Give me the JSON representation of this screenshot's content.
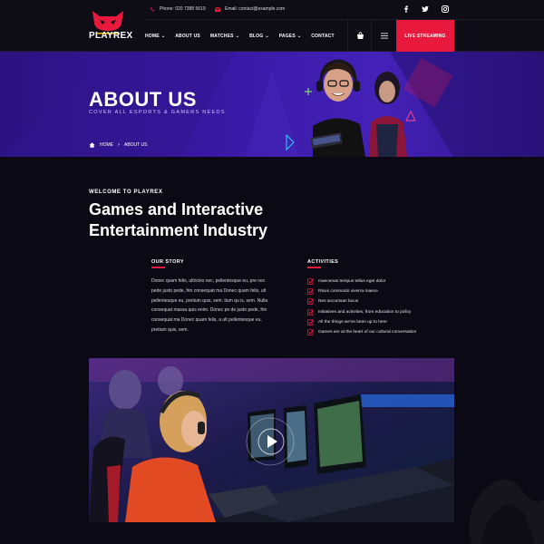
{
  "brand": {
    "name": "PLAYREX"
  },
  "topbar": {
    "phone": "Phone: 020 7388 5619",
    "email": "Email: contact@example.com",
    "social": [
      "facebook-icon",
      "twitter-icon",
      "instagram-icon"
    ]
  },
  "nav": {
    "items": [
      {
        "label": "HOME",
        "has_dropdown": true
      },
      {
        "label": "ABOUT US",
        "has_dropdown": false
      },
      {
        "label": "MATCHES",
        "has_dropdown": true
      },
      {
        "label": "BLOG",
        "has_dropdown": true
      },
      {
        "label": "PAGES",
        "has_dropdown": true
      },
      {
        "label": "CONTACT",
        "has_dropdown": false
      }
    ],
    "cta": "LIVE STREAMING"
  },
  "hero": {
    "title": "ABOUT US",
    "subtitle": "COVER ALL ESPORTS & GAMERS NEEDS",
    "breadcrumb": [
      "HOME",
      "ABOUT US"
    ]
  },
  "intro": {
    "kicker": "WELCOME TO PLAYREX",
    "headline": "Games and Interactive Entertainment Industry"
  },
  "story": {
    "title": "OUR STORY",
    "text": "Donec quam felis, ultricies nec, pellentesque eu, pre nec pede justo pede, frin consequat ma Donec quam felis, ult pellentesque eu, pretium quis, sem. tium qu is, sem. Nulla consequat massa quis enim. Donec pe de justo pede, frin consequat ma Donec quam felis, a ult pellentesque eu, pretium quis, sem."
  },
  "activities": {
    "title": "ACTIVITIES",
    "items": [
      "maecenas tempus tellus eget dolor",
      "Risus commodo viverra maece",
      "Nes accumsan lacus",
      "Initiatives and activities, from education to policy",
      "All the things we've been up to here",
      "Games are at the heart of our cultural conversation"
    ]
  },
  "colors": {
    "accent": "#e8193c",
    "hero": "#3a1aa8",
    "bg": "#0b0a14"
  }
}
